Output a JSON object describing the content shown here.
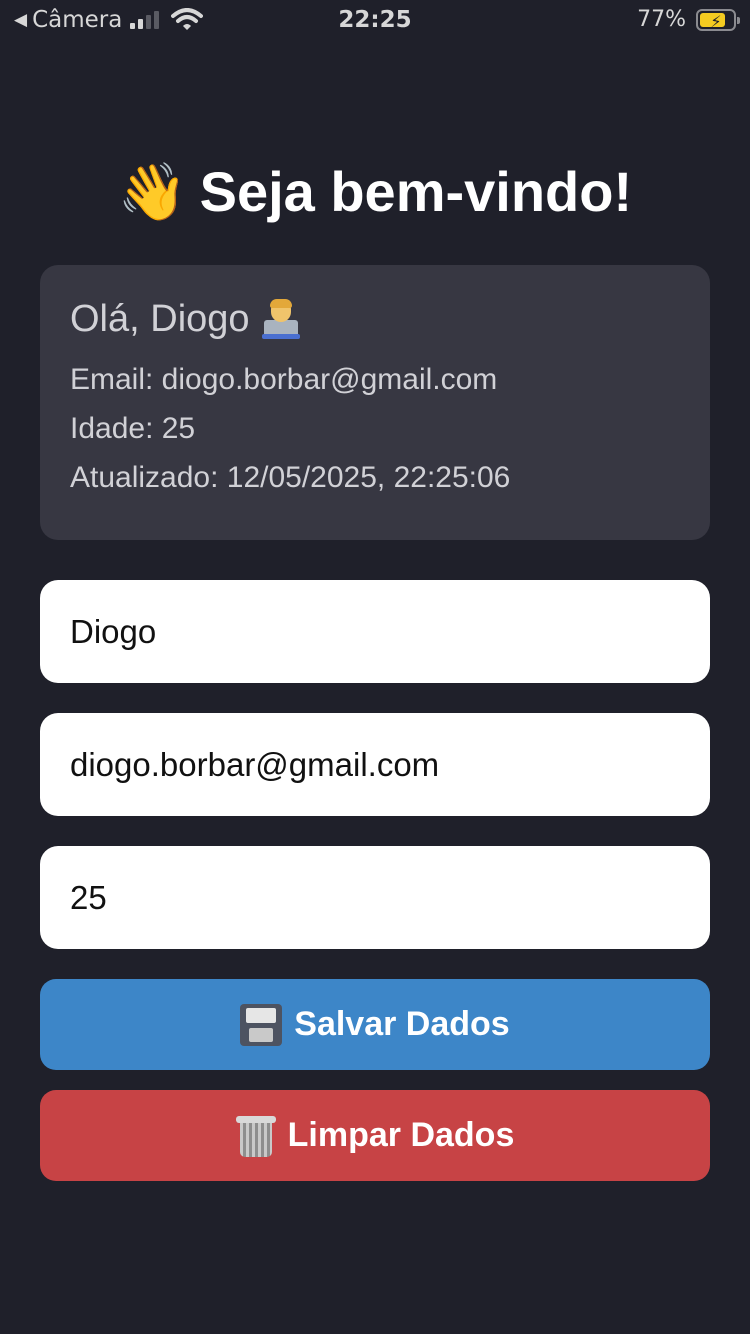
{
  "status_bar": {
    "back_label": "Câmera",
    "time": "22:25",
    "battery_percent": "77%",
    "battery_level": 0.77,
    "charging": true,
    "icons": [
      "back-arrow-icon",
      "cellular-signal-icon",
      "wifi-icon",
      "battery-charging-icon"
    ]
  },
  "header": {
    "emoji": "👋",
    "title": "Seja bem-vindo!"
  },
  "info_card": {
    "greeting": "Olá, Diogo",
    "greeting_icon": "technologist-emoji-icon",
    "email_line": "Email: diogo.borbar@gmail.com",
    "age_line": "Idade: 25",
    "updated_line": "Atualizado: 12/05/2025, 22:25:06"
  },
  "form": {
    "name_value": "Diogo",
    "email_value": "diogo.borbar@gmail.com",
    "age_value": "25"
  },
  "buttons": {
    "save_label": "Salvar Dados",
    "save_icon": "floppy-disk-icon",
    "clear_label": "Limpar Dados",
    "clear_icon": "wastebasket-icon"
  },
  "colors": {
    "background": "#1f202a",
    "card": "#373742",
    "save_button": "#3d86c8",
    "clear_button": "#c74345",
    "battery": "#f5cc21"
  }
}
